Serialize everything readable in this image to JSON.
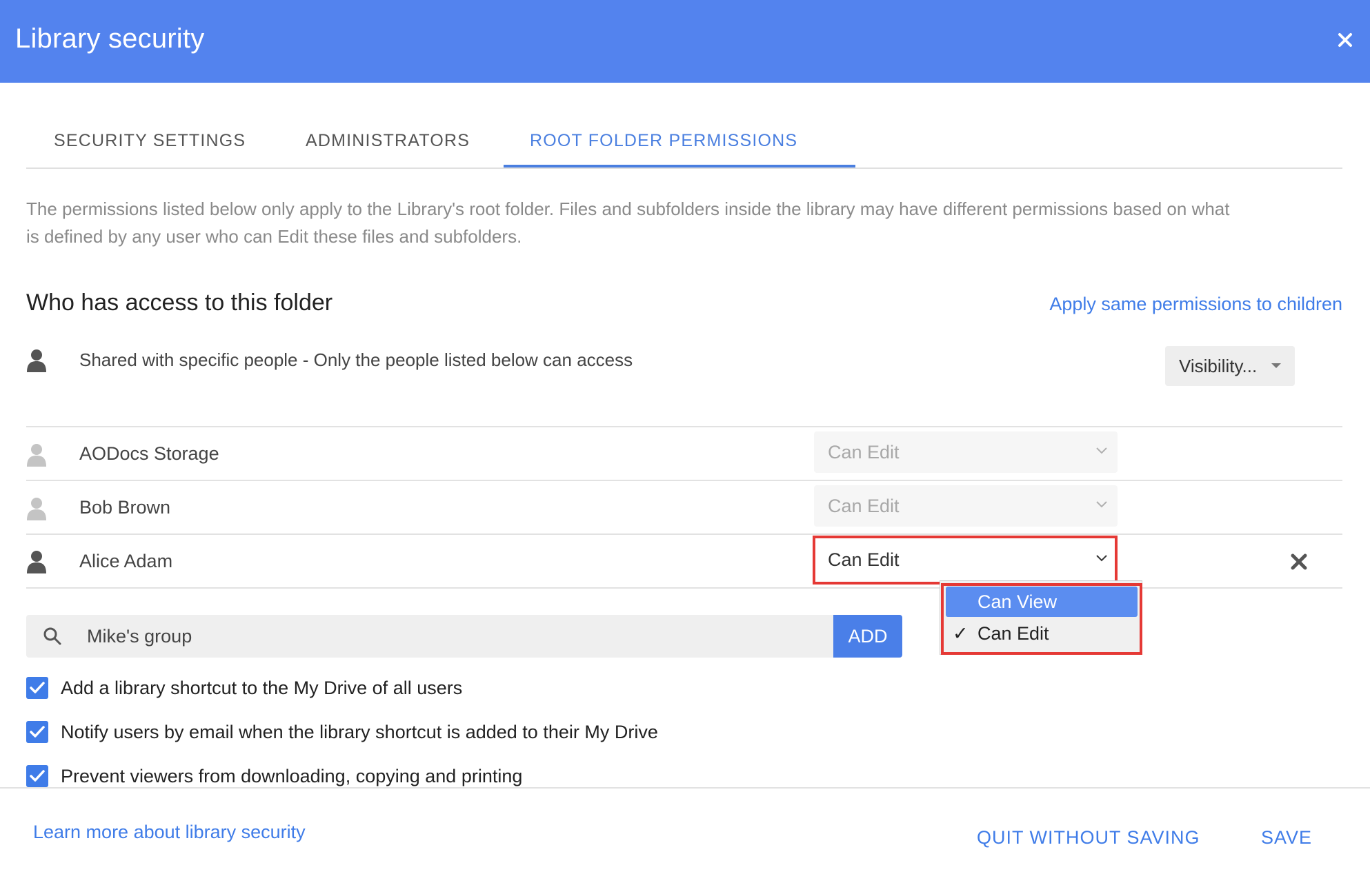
{
  "window": {
    "title": "Library security",
    "close_icon": "close-icon"
  },
  "tabs": [
    {
      "label": "SECURITY SETTINGS",
      "active": false
    },
    {
      "label": "ADMINISTRATORS",
      "active": false
    },
    {
      "label": "ROOT FOLDER PERMISSIONS",
      "active": true
    }
  ],
  "description": "The permissions listed below only apply to the Library's root folder. Files and subfolders inside the library may have different permissions based on what is defined by any user who can Edit these files and subfolders.",
  "access": {
    "title": "Who has access to this folder",
    "apply_link": "Apply same permissions to children",
    "shared_text": "Shared with specific people - Only the people listed below can access",
    "visibility_label": "Visibility..."
  },
  "users": [
    {
      "name": "AODocs Storage",
      "permission": "Can Edit",
      "editable": false
    },
    {
      "name": "Bob Brown",
      "permission": "Can Edit",
      "editable": false
    },
    {
      "name": "Alice Adam",
      "permission": "Can Edit",
      "editable": true
    }
  ],
  "permission_dropdown": {
    "options": [
      "Can View",
      "Can Edit"
    ],
    "hovered": "Can View",
    "selected": "Can Edit",
    "check_mark": "✓"
  },
  "add_user": {
    "value": "Mike's group",
    "button_label": "ADD"
  },
  "options": [
    {
      "label": "Add a library shortcut to the My Drive of all users",
      "checked": true
    },
    {
      "label": "Notify users by email when the library shortcut is added to their My Drive",
      "checked": true
    },
    {
      "label": "Prevent viewers from downloading, copying and printing",
      "checked": true
    }
  ],
  "footer": {
    "learn_more": "Learn more about library security",
    "quit_label": "QUIT WITHOUT SAVING",
    "save_label": "SAVE"
  },
  "colors": {
    "header": "#5383ee",
    "accent": "#3f7ce8",
    "highlight": "#e53935"
  }
}
